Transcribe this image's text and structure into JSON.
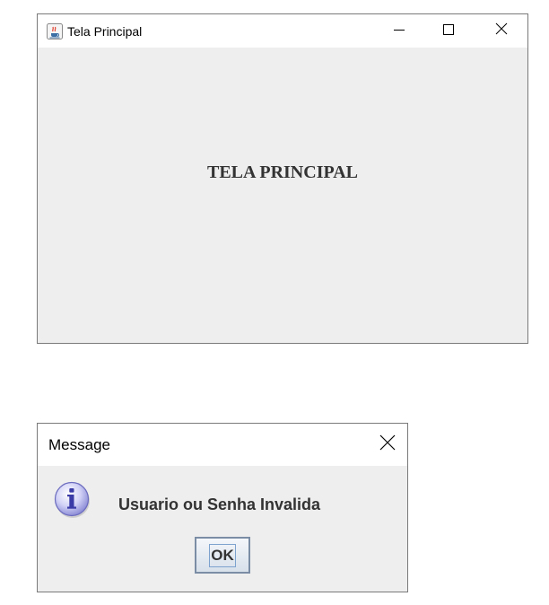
{
  "main_window": {
    "title": "Tela Principal",
    "heading": "TELA PRINCIPAL",
    "icons": {
      "app": "java-coffee-icon",
      "minimize": "minimize-icon",
      "maximize": "maximize-icon",
      "close": "close-icon"
    }
  },
  "dialog": {
    "title": "Message",
    "message": "Usuario ou Senha Invalida",
    "ok_label": "OK",
    "icons": {
      "info": "info-icon",
      "close": "close-icon"
    }
  }
}
